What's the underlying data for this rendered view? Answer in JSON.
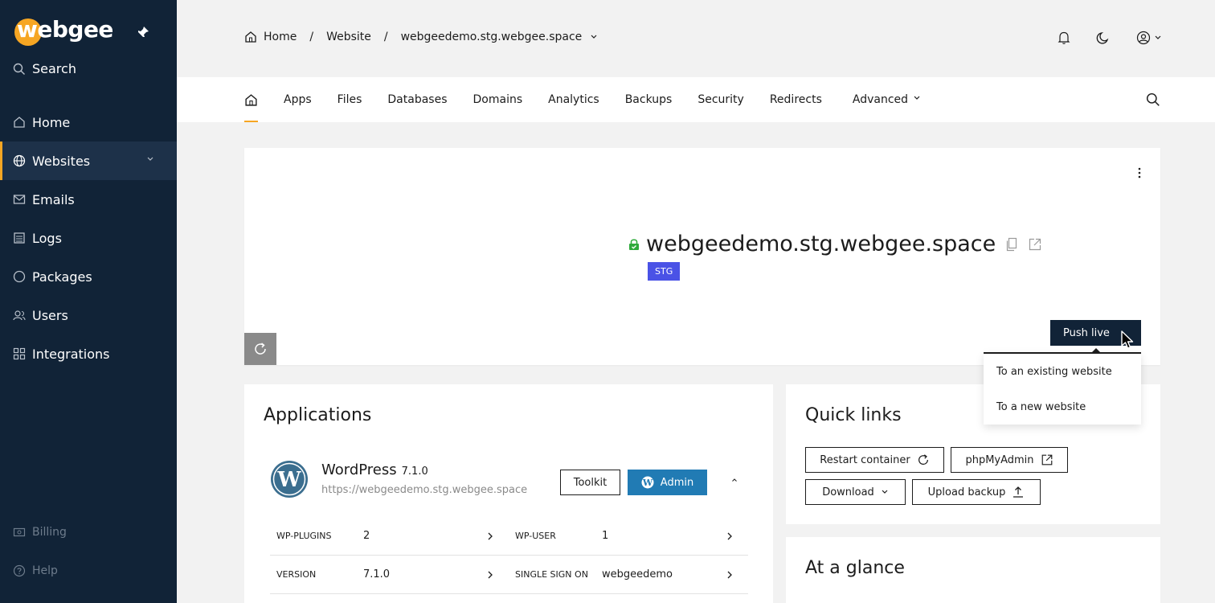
{
  "sidebar": {
    "logo": "webgee",
    "search_label": "Search",
    "items": [
      {
        "label": "Home",
        "icon": "home-icon"
      },
      {
        "label": "Websites",
        "icon": "globe-icon",
        "active": true
      },
      {
        "label": "Emails",
        "icon": "mail-icon"
      },
      {
        "label": "Logs",
        "icon": "logs-icon"
      },
      {
        "label": "Packages",
        "icon": "packages-icon"
      },
      {
        "label": "Users",
        "icon": "users-icon"
      },
      {
        "label": "Integrations",
        "icon": "integrations-icon"
      }
    ],
    "bottom": [
      {
        "label": "Billing",
        "icon": "billing-icon"
      },
      {
        "label": "Help",
        "icon": "help-icon"
      }
    ]
  },
  "breadcrumb": {
    "home": "Home",
    "sep": "/",
    "website": "Website",
    "current": "webgeedemo.stg.webgee.space"
  },
  "tabs": [
    "Apps",
    "Files",
    "Databases",
    "Domains",
    "Analytics",
    "Backups",
    "Security",
    "Redirects",
    "Advanced"
  ],
  "hero": {
    "domain": "webgeedemo.stg.webgee.space",
    "badge": "STG",
    "push_live": "Push live",
    "push_options": [
      "To an existing website",
      "To a new website"
    ]
  },
  "applications": {
    "title": "Applications",
    "app_name": "WordPress",
    "app_version": "7.1.0",
    "app_url": "https://webgeedemo.stg.webgee.space",
    "toolkit": "Toolkit",
    "admin": "Admin",
    "rows": [
      {
        "l1": "WP-PLUGINS",
        "v1": "2",
        "l2": "WP-USER",
        "v2": "1"
      },
      {
        "l1": "VERSION",
        "v1": "7.1.0",
        "l2": "SINGLE SIGN ON",
        "v2": "webgeedemo"
      }
    ]
  },
  "quick_links": {
    "title": "Quick links",
    "restart": "Restart container",
    "phpmyadmin": "phpMyAdmin",
    "download": "Download",
    "upload": "Upload backup"
  },
  "glance": {
    "title": "At a glance"
  },
  "colors": {
    "sidebar_bg": "#112337",
    "accent": "#f6a623",
    "badge": "#4a52e6",
    "admin": "#217bb4",
    "lock": "#2eaa3a"
  }
}
